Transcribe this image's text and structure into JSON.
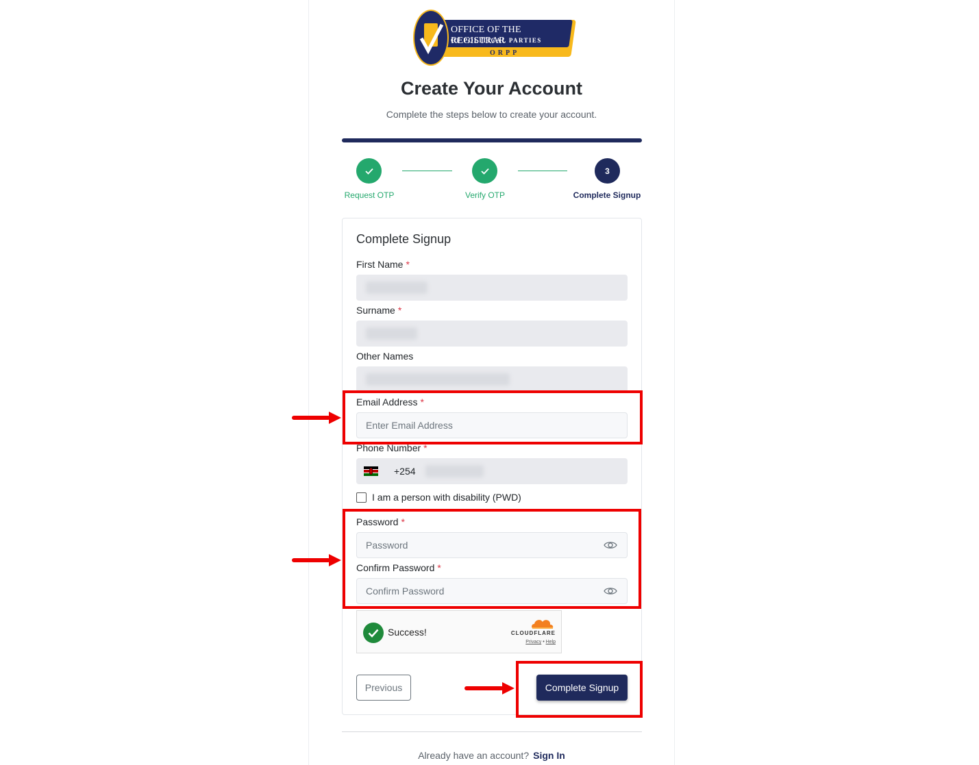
{
  "colors": {
    "primary": "#1f2a5c",
    "success": "#24a86d",
    "required": "#dc3545",
    "annotation": "#ee0000"
  },
  "logo": {
    "line1": "OFFICE OF THE REGISTRAR",
    "line2": "OF POLITICAL PARTIES",
    "line3": "ORPP"
  },
  "header": {
    "title": "Create Your Account",
    "subtitle": "Complete the steps below to create your account."
  },
  "steps": [
    {
      "label": "Request OTP",
      "status": "done"
    },
    {
      "label": "Verify OTP",
      "status": "done"
    },
    {
      "label": "Complete Signup",
      "status": "active",
      "number": "3"
    }
  ],
  "form": {
    "title": "Complete Signup",
    "required_mark": "*",
    "first_name": {
      "label": "First Name"
    },
    "surname": {
      "label": "Surname"
    },
    "other_names": {
      "label": "Other Names"
    },
    "email": {
      "label": "Email Address",
      "placeholder": "Enter Email Address"
    },
    "phone": {
      "label": "Phone Number",
      "code": "+254",
      "flag_icon": "kenya-flag-icon"
    },
    "pwd": {
      "label": "I am a person with disability (PWD)",
      "checked": false
    },
    "password": {
      "label": "Password",
      "placeholder": "Password"
    },
    "confirm_password": {
      "label": "Confirm Password",
      "placeholder": "Confirm Password"
    },
    "captcha": {
      "status": "Success!",
      "brand": "CLOUDFLARE",
      "privacy": "Privacy",
      "separator": "•",
      "help": "Help"
    },
    "previous_label": "Previous",
    "submit_label": "Complete Signup"
  },
  "footer": {
    "text": "Already have an account?",
    "link": "Sign In"
  }
}
